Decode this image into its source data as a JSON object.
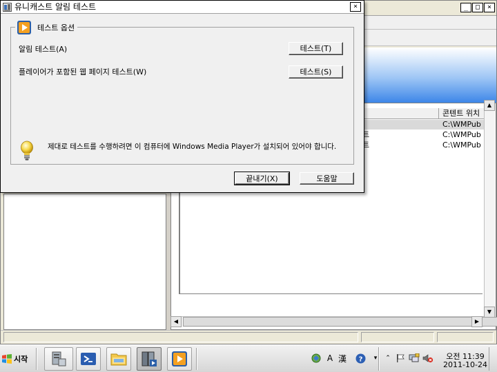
{
  "dialog": {
    "title": "유니캐스트 알림 테스트",
    "close_glyph": "×",
    "group_title": "테스트 옵션",
    "options": [
      {
        "label": "알림 테스트(A)",
        "button": "테스트(T)"
      },
      {
        "label": "플레이어가 포함된 웹 페이지 테스트(W)",
        "button": "테스트(S)"
      }
    ],
    "note": "제대로 테스트를 수행하려면 이 컴퓨터에  Windows Media Player가 설치되어 있어야 합니다.",
    "close_button": "끝내기(X)",
    "help_button": "도움말"
  },
  "background_window": {
    "controls": [
      "_",
      "□",
      "×"
    ],
    "list_header": {
      "col1": "",
      "col2": "콘텐트 위치"
    },
    "rows": [
      {
        "name": "",
        "location": "C:\\WMPub",
        "selected": true
      },
      {
        "name": "트",
        "location": "C:\\WMPub",
        "selected": false
      },
      {
        "name": "트",
        "location": "C:\\WMPub",
        "selected": false
      }
    ]
  },
  "taskbar": {
    "start_label": "시작",
    "apps": [
      "server-manager-icon",
      "powershell-icon",
      "explorer-icon",
      "wms-admin-icon",
      "media-player-icon"
    ],
    "tray": {
      "lang_a": "A",
      "lang_han": "漢",
      "time": "오전 11:39",
      "date": "2011-10-24"
    }
  },
  "colors": {
    "titlebar": "#ffffff",
    "dialog_bg": "#f0f0f0",
    "selected_row": "#d9d9d9",
    "gradient_blue": "#3d86e8"
  }
}
